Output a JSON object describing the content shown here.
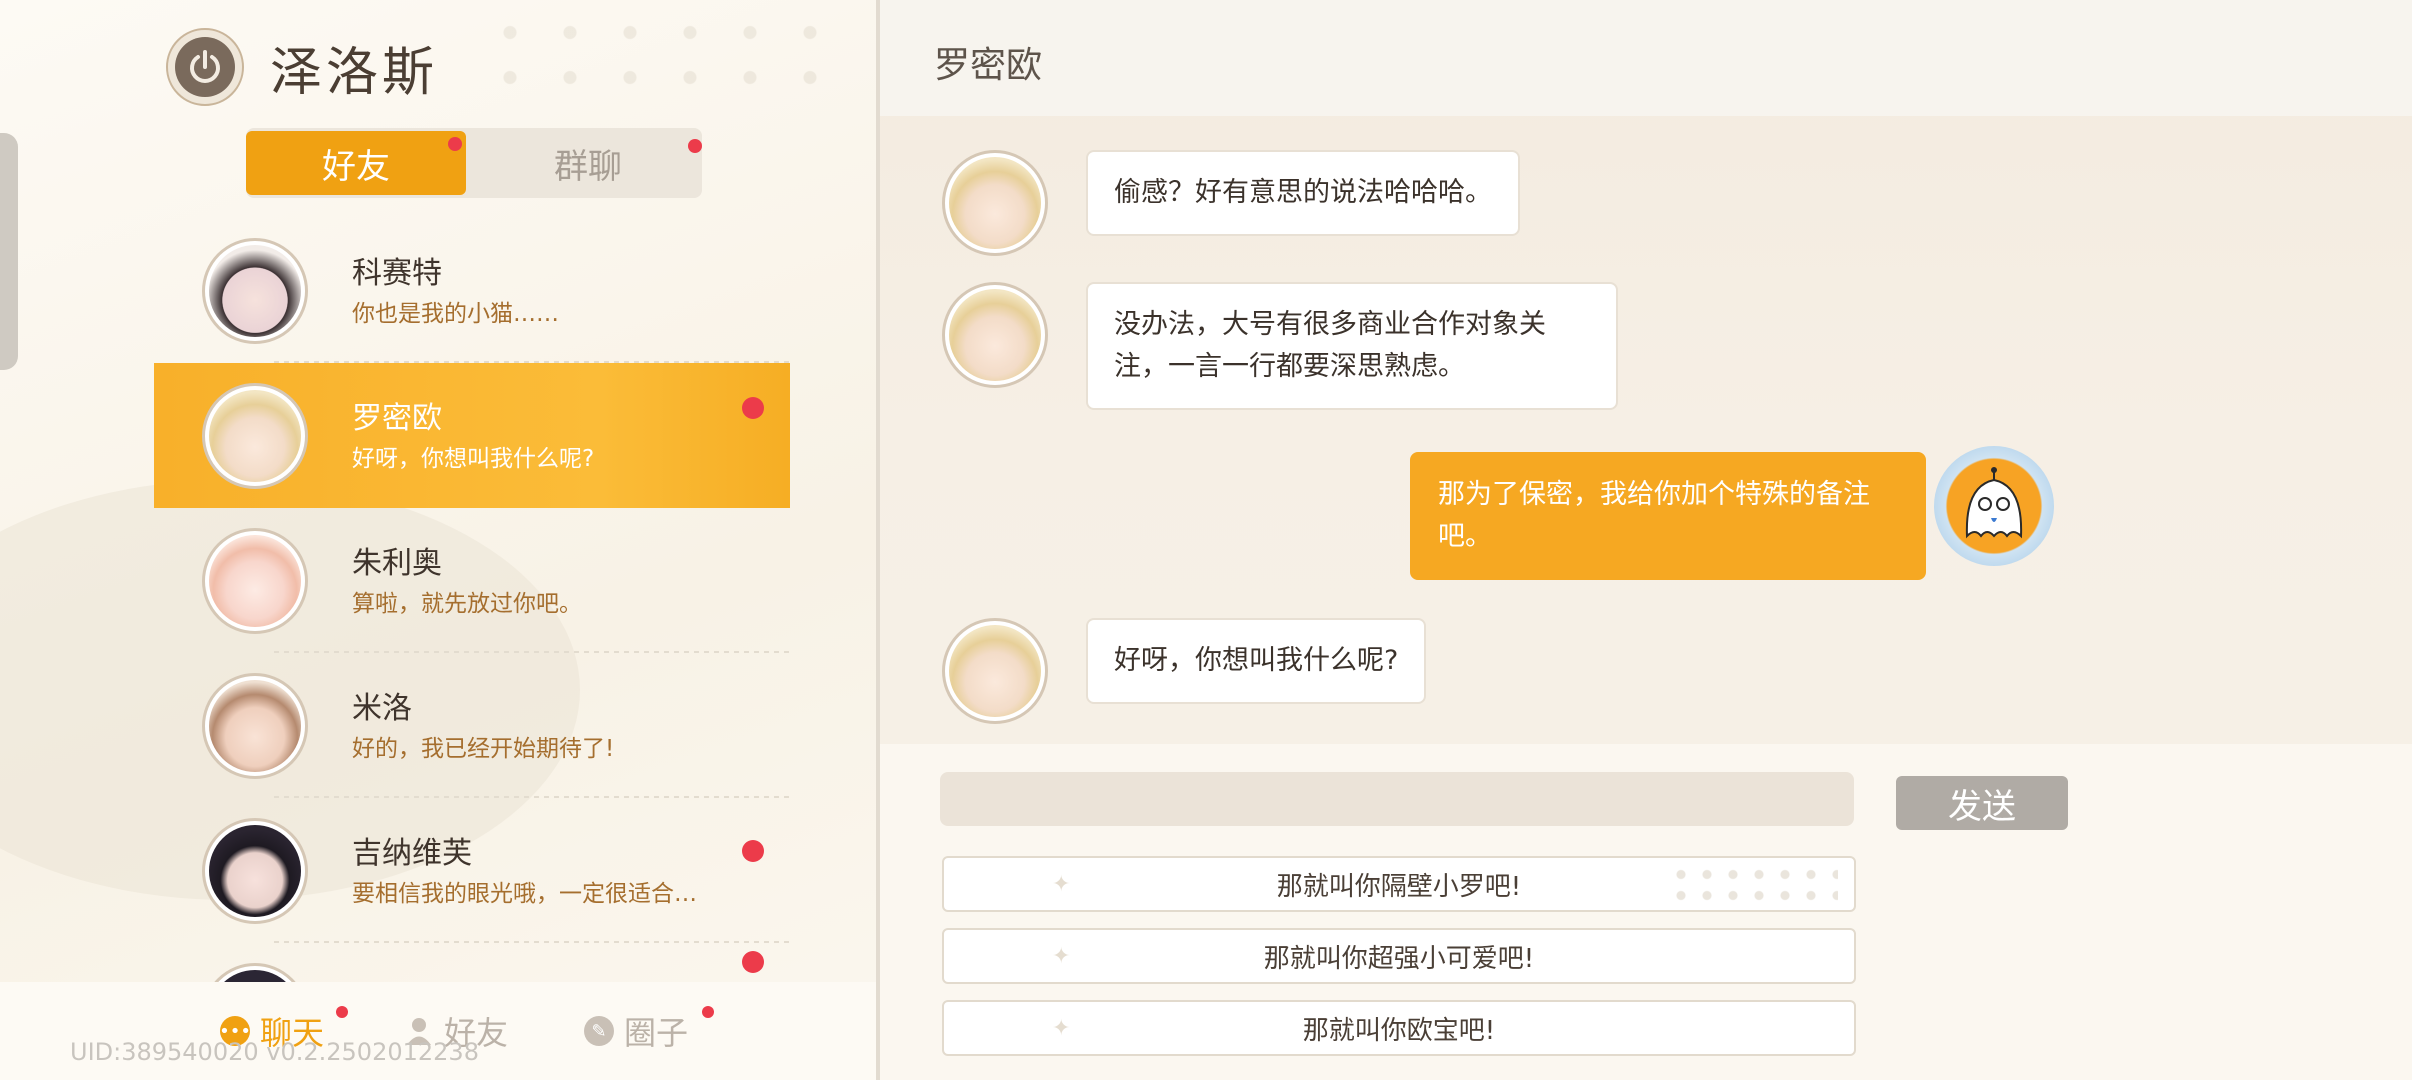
{
  "player": {
    "name": "泽洛斯"
  },
  "tabs": {
    "friends": "好友",
    "groups": "群聊"
  },
  "contacts": [
    {
      "name": "科赛特",
      "message": "你也是我的小猫……",
      "unread": false,
      "active": false
    },
    {
      "name": "罗密欧",
      "message": "好呀，你想叫我什么呢?",
      "unread": true,
      "active": true
    },
    {
      "name": "朱利奥",
      "message": "算啦，就先放过你吧。",
      "unread": false,
      "active": false
    },
    {
      "name": "米洛",
      "message": "好的，我已经开始期待了!",
      "unread": false,
      "active": false
    },
    {
      "name": "吉纳维芙",
      "message": "要相信我的眼光哦，一定很适合…",
      "unread": true,
      "active": false
    }
  ],
  "bottom_nav": {
    "chat": "聊天",
    "friends": "好友",
    "circle": "圈子"
  },
  "uid": "UID:389540020 v0.2.2502012238",
  "chat": {
    "title": "罗密欧",
    "messages": [
      {
        "from": "other",
        "text": "偷感？好有意思的说法哈哈哈。"
      },
      {
        "from": "other",
        "text": "没办法，大号有很多商业合作对象关注，一言一行都要深思熟虑。"
      },
      {
        "from": "me",
        "text": "那为了保密，我给你加个特殊的备注吧。"
      },
      {
        "from": "other",
        "text": "好呀，你想叫我什么呢?"
      }
    ],
    "send_label": "发送",
    "reply_options": [
      "那就叫你隔壁小罗吧!",
      "那就叫你超强小可爱吧!",
      "那就叫你欧宝吧!"
    ]
  },
  "colors": {
    "accent": "#f0a112",
    "unread_dot": "#ec3b4a"
  }
}
